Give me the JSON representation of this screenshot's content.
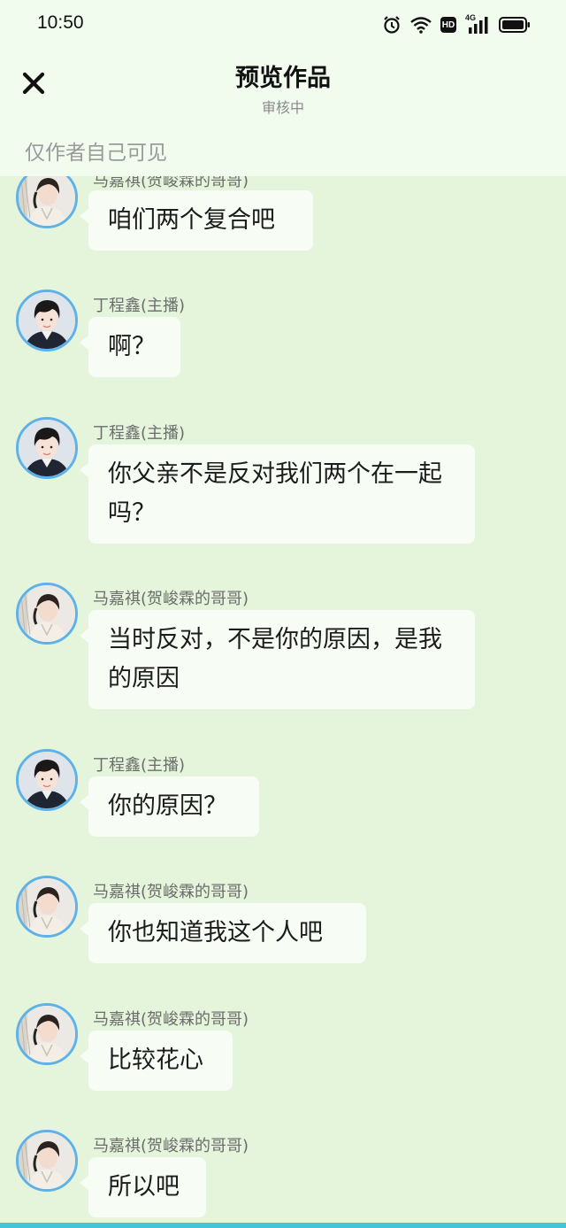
{
  "status_bar": {
    "time": "10:50",
    "icons": [
      "alarm-icon",
      "wifi-icon",
      "hd-icon",
      "signal-4g-icon",
      "battery-icon"
    ],
    "hd_label": "HD",
    "network_label": "4G"
  },
  "header": {
    "title": "预览作品",
    "subtitle": "审核中",
    "visibility_note": "仅作者自己可见"
  },
  "colors": {
    "background": "#e4f5dc",
    "header_bg": "#f1fcef",
    "bubble_bg": "#f7fcf5",
    "avatar_ring": "#5eb2e8"
  },
  "messages": [
    {
      "sender": "马嘉祺(贺峻霖的哥哥)",
      "avatar": "avatar-majiaqi",
      "text": "咱们两个复合吧"
    },
    {
      "sender": "丁程鑫(主播)",
      "avatar": "avatar-dingchengxin",
      "text": "啊？"
    },
    {
      "sender": "丁程鑫(主播)",
      "avatar": "avatar-dingchengxin",
      "text": "你父亲不是反对我们两个在一起吗？"
    },
    {
      "sender": "马嘉祺(贺峻霖的哥哥)",
      "avatar": "avatar-majiaqi",
      "text": "当时反对，不是你的原因，是我的原因"
    },
    {
      "sender": "丁程鑫(主播)",
      "avatar": "avatar-dingchengxin",
      "text": "你的原因？"
    },
    {
      "sender": "马嘉祺(贺峻霖的哥哥)",
      "avatar": "avatar-majiaqi",
      "text": "你也知道我这个人吧"
    },
    {
      "sender": "马嘉祺(贺峻霖的哥哥)",
      "avatar": "avatar-majiaqi",
      "text": "比较花心"
    },
    {
      "sender": "马嘉祺(贺峻霖的哥哥)",
      "avatar": "avatar-majiaqi",
      "text": "所以吧"
    }
  ]
}
